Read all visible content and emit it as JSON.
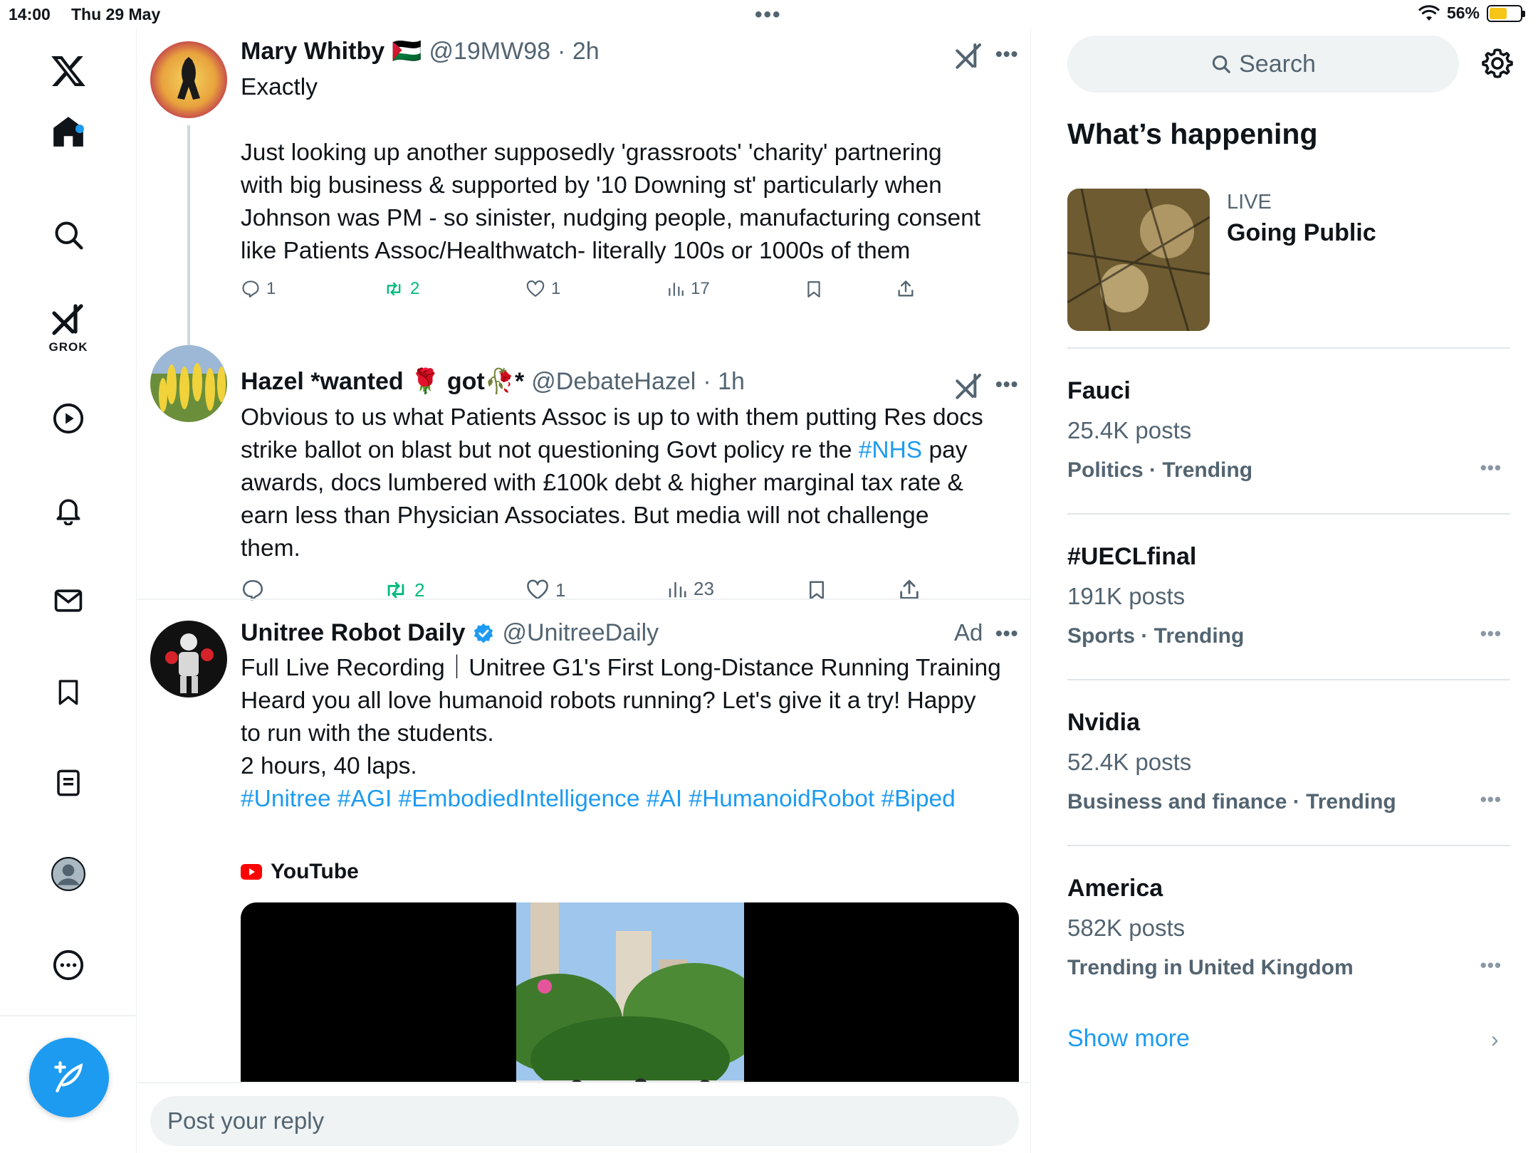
{
  "status_bar": {
    "time": "14:00",
    "date": "Thu 29 May",
    "battery": "56%",
    "battery_level": 0.56
  },
  "nav": {
    "grok_label": "GROK",
    "items": [
      "x-logo",
      "home",
      "explore",
      "grok",
      "videos",
      "notifications",
      "messages",
      "bookmarks",
      "lists",
      "profile",
      "more"
    ]
  },
  "tweets": [
    {
      "name": "Mary Whitby",
      "flag": "🇵🇸",
      "handle": "@19MW98",
      "time": "· 2h",
      "text_lines": [
        "Exactly",
        "",
        "Just looking up another supposedly 'grassroots'  'charity' partnering",
        "with big business & supported by '10 Downing st' particularly when",
        "Johnson was PM - so sinister, nudging people, manufacturing consent",
        "like Patients Assoc/Healthwatch- literally 100s or 1000s of them"
      ],
      "replies": "1",
      "reposts": "2",
      "likes": "1",
      "views": "17"
    },
    {
      "name": "Hazel *wanted 🌹 got🥀*",
      "handle": "@DebateHazel",
      "time": "· 1h",
      "text_a": "Obvious to us what Patients Assoc is up to with them putting Res docs",
      "text_b": "strike ballot on blast but not questioning Govt policy re the ",
      "text_hashtag": "#NHS",
      "text_c": " pay",
      "text_d": "awards, docs lumbered with £100k debt & higher marginal tax rate &",
      "text_e": "earn less than Physician Associates. But media will not challenge",
      "text_f": "them.",
      "replies": "",
      "reposts": "2",
      "likes": "1",
      "views": "23"
    },
    {
      "name": "Unitree Robot Daily",
      "handle": "@UnitreeDaily",
      "ad_label": "Ad",
      "text_lines": [
        "Full Live Recording｜Unitree G1's First Long-Distance Running Training",
        "Heard you all love humanoid robots running? Let's give it a try!  Happy",
        "to run with the students.",
        "2 hours, 40 laps."
      ],
      "hashtags": "#Unitree #AGI #EmbodiedIntelligence #AI #HumanoidRobot #Biped",
      "source": "YouTube"
    }
  ],
  "reply_placeholder": "Post your reply",
  "sidebar": {
    "search_label": "Search",
    "title": "What’s happening",
    "live": {
      "label": "LIVE",
      "title": "Going Public"
    },
    "trends": [
      {
        "name": "Fauci",
        "count": "25.4K posts",
        "category": "Politics · Trending"
      },
      {
        "name": "#UECLfinal",
        "count": "191K posts",
        "category": "Sports · Trending"
      },
      {
        "name": "Nvidia",
        "count": "52.4K posts",
        "category": "Business and finance · Trending"
      },
      {
        "name": "America",
        "count": "582K posts",
        "category": "Trending in United Kingdom"
      }
    ],
    "show_more": "Show more"
  },
  "colors": {
    "accent": "#1d9bf0",
    "repost": "#00ba7c",
    "muted": "#536471"
  }
}
